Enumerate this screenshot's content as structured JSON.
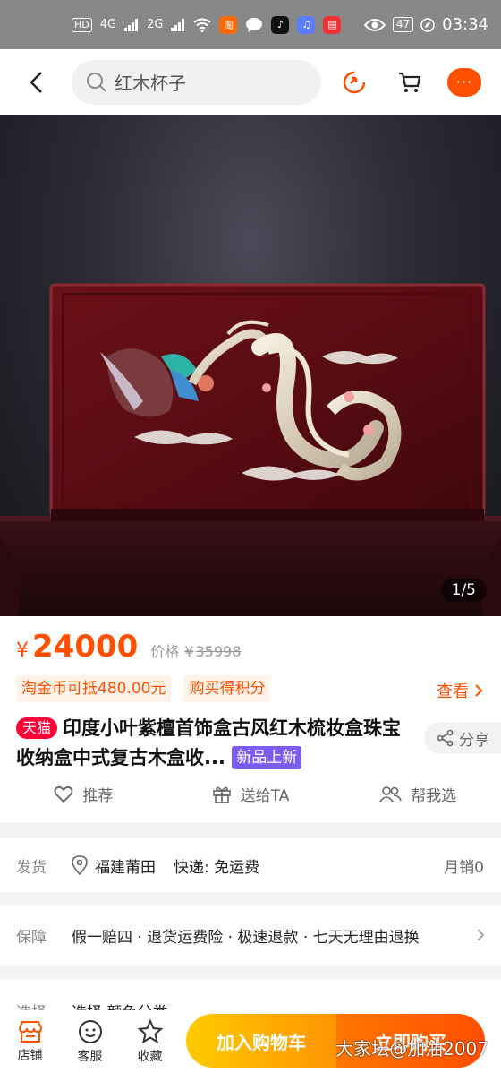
{
  "status_bar": {
    "network": "HD",
    "sim1": "4G",
    "sim2": "2G",
    "battery": "47",
    "time": "03:34"
  },
  "header": {
    "search_text": "红木杯子",
    "more_label": "···"
  },
  "hero": {
    "image_counter": "1/5"
  },
  "price": {
    "currency": "¥",
    "current": "24000",
    "original_label": "价格",
    "original_currency": "¥",
    "original": "35998"
  },
  "promos": [
    "淘金币可抵480.00元",
    "购买得积分"
  ],
  "view_more_label": "查看",
  "product": {
    "store_badge": "天猫",
    "title": "印度小叶紫檀首饰盒古风红木梳妆盒珠宝收纳盒中式复古木盒收...",
    "new_tag": "新品上新"
  },
  "share_label": "分享",
  "actions": {
    "recommend": "推荐",
    "gift": "送给TA",
    "help": "帮我选"
  },
  "shipping": {
    "label": "发货",
    "location": "福建莆田",
    "express": "快递: 免运费",
    "monthly_sales": "月销0"
  },
  "guarantee": {
    "label": "保障",
    "text": "假一赔四 · 退货运费险 · 极速退款 · 七天无理由退换"
  },
  "selection": {
    "label": "选择",
    "text": "选择 颜色分类"
  },
  "bottom_bar": {
    "store": "店铺",
    "service": "客服",
    "favorite": "收藏",
    "add_to_cart": "加入购物车",
    "buy_now": "立即购买"
  },
  "watermark": "大家坛@加油2007",
  "colors": {
    "accent": "#ff5000",
    "tmall": "#ff0036",
    "new_tag": "#7b5cf0"
  }
}
